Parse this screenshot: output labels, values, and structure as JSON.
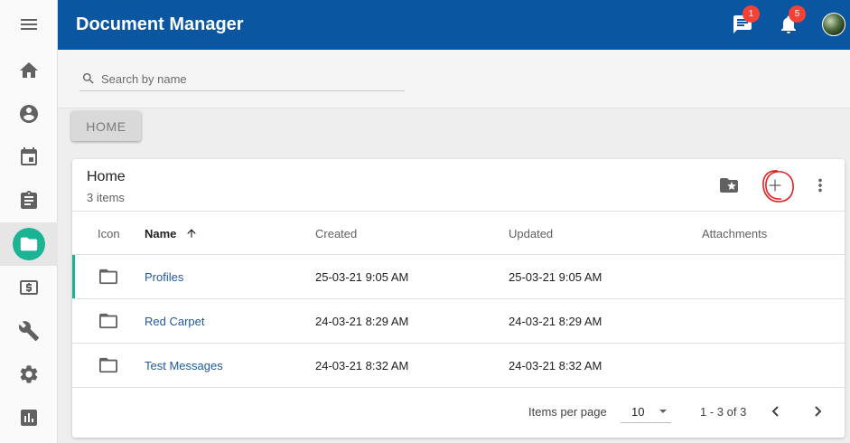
{
  "app": {
    "title": "Document Manager"
  },
  "header": {
    "messages_badge": "1",
    "notifications_badge": "5"
  },
  "sidebar": {
    "items": [
      {
        "icon": "menu-icon"
      },
      {
        "icon": "home-icon"
      },
      {
        "icon": "account-circle-icon"
      },
      {
        "icon": "calendar-icon"
      },
      {
        "icon": "clipboard-icon"
      },
      {
        "icon": "folder-icon",
        "active": true
      },
      {
        "icon": "money-icon"
      },
      {
        "icon": "wrench-icon"
      },
      {
        "icon": "gear-icon"
      },
      {
        "icon": "bar-chart-icon"
      }
    ]
  },
  "search": {
    "placeholder": "Search by name",
    "value": ""
  },
  "breadcrumb": {
    "home_label": "HOME"
  },
  "card": {
    "title": "Home",
    "subtitle": "3 items",
    "columns": {
      "icon": "Icon",
      "name": "Name",
      "created": "Created",
      "updated": "Updated",
      "attachments": "Attachments"
    },
    "rows": [
      {
        "name": "Profiles",
        "created": "25-03-21 9:05 AM",
        "updated": "25-03-21 9:05 AM",
        "attachments": ""
      },
      {
        "name": "Red Carpet",
        "created": "24-03-21 8:29 AM",
        "updated": "24-03-21 8:29 AM",
        "attachments": ""
      },
      {
        "name": "Test Messages",
        "created": "24-03-21 8:32 AM",
        "updated": "24-03-21 8:32 AM",
        "attachments": ""
      }
    ]
  },
  "pager": {
    "items_per_page_label": "Items per page",
    "items_per_page_value": "10",
    "range": "1 - 3 of 3"
  },
  "colors": {
    "header": "#0a56a0",
    "accent": "#1ab394",
    "annotation": "#e0201f"
  }
}
